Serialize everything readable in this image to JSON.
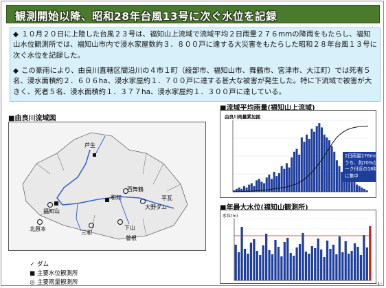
{
  "title": "観測開始以降、昭和28年台風13号に次ぐ水位を記録",
  "intro": {
    "para1": "１０月２０日に上陸した台風２３号は、福知山上流域で流域平均２日雨量２７６mmの降雨をもたらし、福知山水位観測所では、福知山市内で浸水家屋数約３．８００戸に達する大災害をもたらした昭和２８年台風１３号に次ぐ水位を記録した。",
    "para2": "この豪雨により、由良川直轄区間沿川の４市１町（綾部市、福知山市、舞鶴市、宮津市、大江町）では死者５名、浸水面積約２．６０６ha、浸水家屋約１．７００戸に達する甚大な被害が発生した。特に下流域で被害が大きく、死者５名、浸水面積約１．３７７ha、浸水家屋約１．３００戸に達している。",
    "bullet": "◆"
  },
  "map": {
    "heading": "■由良川流域図",
    "labels": {
      "ashiu": "芦生",
      "wachi": "和知",
      "fukuchiyama": "福知山",
      "kitakinki": "北原本",
      "sanwa": "三和",
      "nishifukuchi": "西舞鶴",
      "ooe": "大野ダム",
      "hirano": "平瓦",
      "shimoyama": "下山",
      "yasu": "曽根",
      "ayabe": "綾部"
    },
    "legend": [
      {
        "symbol": "✓",
        "text": "ダム"
      },
      {
        "symbol": "■",
        "text": "主要水位観測所"
      },
      {
        "symbol": "◎",
        "text": "主要雨量観測所"
      }
    ]
  },
  "rain_chart": {
    "heading": "■流域平均雨量(福知山上流域)",
    "inner_title": "由良川雨量累加図",
    "note": "2日雨量276mmのうち、約70%がピーク付近の18時間に集中"
  },
  "level_chart": {
    "heading": "■年最大水位(福知山観測所)",
    "yunit": "水位(m)"
  },
  "page_number": "-1-",
  "colors": {
    "title_bg": "#4a7a2c",
    "intro_bg": "#d8f0fa",
    "bar": "#1e3e9e",
    "river": "#3a63c8"
  },
  "chart_data": [
    {
      "type": "bar",
      "title": "由良川雨量累加図",
      "series_count": 1,
      "values": [
        1,
        2,
        3,
        2,
        4,
        3,
        5,
        6,
        4,
        8,
        9,
        7,
        6,
        10,
        12,
        9,
        14,
        11,
        13,
        18,
        16,
        20,
        17,
        24,
        28,
        30,
        26,
        38,
        35,
        40,
        37,
        44,
        42,
        46,
        48,
        45,
        40,
        38,
        36,
        32,
        28,
        22,
        18,
        14,
        12,
        10,
        9,
        8,
        7,
        5,
        4,
        3,
        2,
        1
      ],
      "cumulative": [
        0,
        0.5,
        1,
        1.5,
        2,
        2.5,
        3,
        4,
        5,
        6,
        7,
        8,
        10,
        12,
        14,
        16,
        18,
        20,
        24,
        28,
        32,
        38,
        46,
        56,
        68,
        80,
        95,
        112,
        130,
        150,
        170,
        190,
        210,
        228,
        240,
        250,
        258,
        264,
        268,
        271,
        273,
        274,
        275,
        276
      ],
      "ylim": [
        0,
        50
      ]
    },
    {
      "type": "bar",
      "title": "年最大水位",
      "ylabel": "水位(m)",
      "values": [
        5.2,
        4.1,
        7.8,
        4.6,
        3.9,
        5.5,
        6.0,
        4.3,
        3.7,
        5.1,
        6.8,
        4.4,
        3.8,
        5.9,
        4.9,
        3.5,
        5.6,
        6.2,
        4.0,
        3.6,
        4.8,
        5.3,
        6.9,
        4.2,
        3.9,
        5.0,
        4.7,
        6.1,
        4.5,
        3.4,
        5.8,
        4.6,
        5.2,
        3.8,
        6.4,
        4.1,
        5.7,
        3.9,
        4.3,
        5.4,
        4.9,
        3.7,
        6.6,
        4.8,
        7.9
      ],
      "ylim": [
        0,
        9
      ]
    }
  ]
}
